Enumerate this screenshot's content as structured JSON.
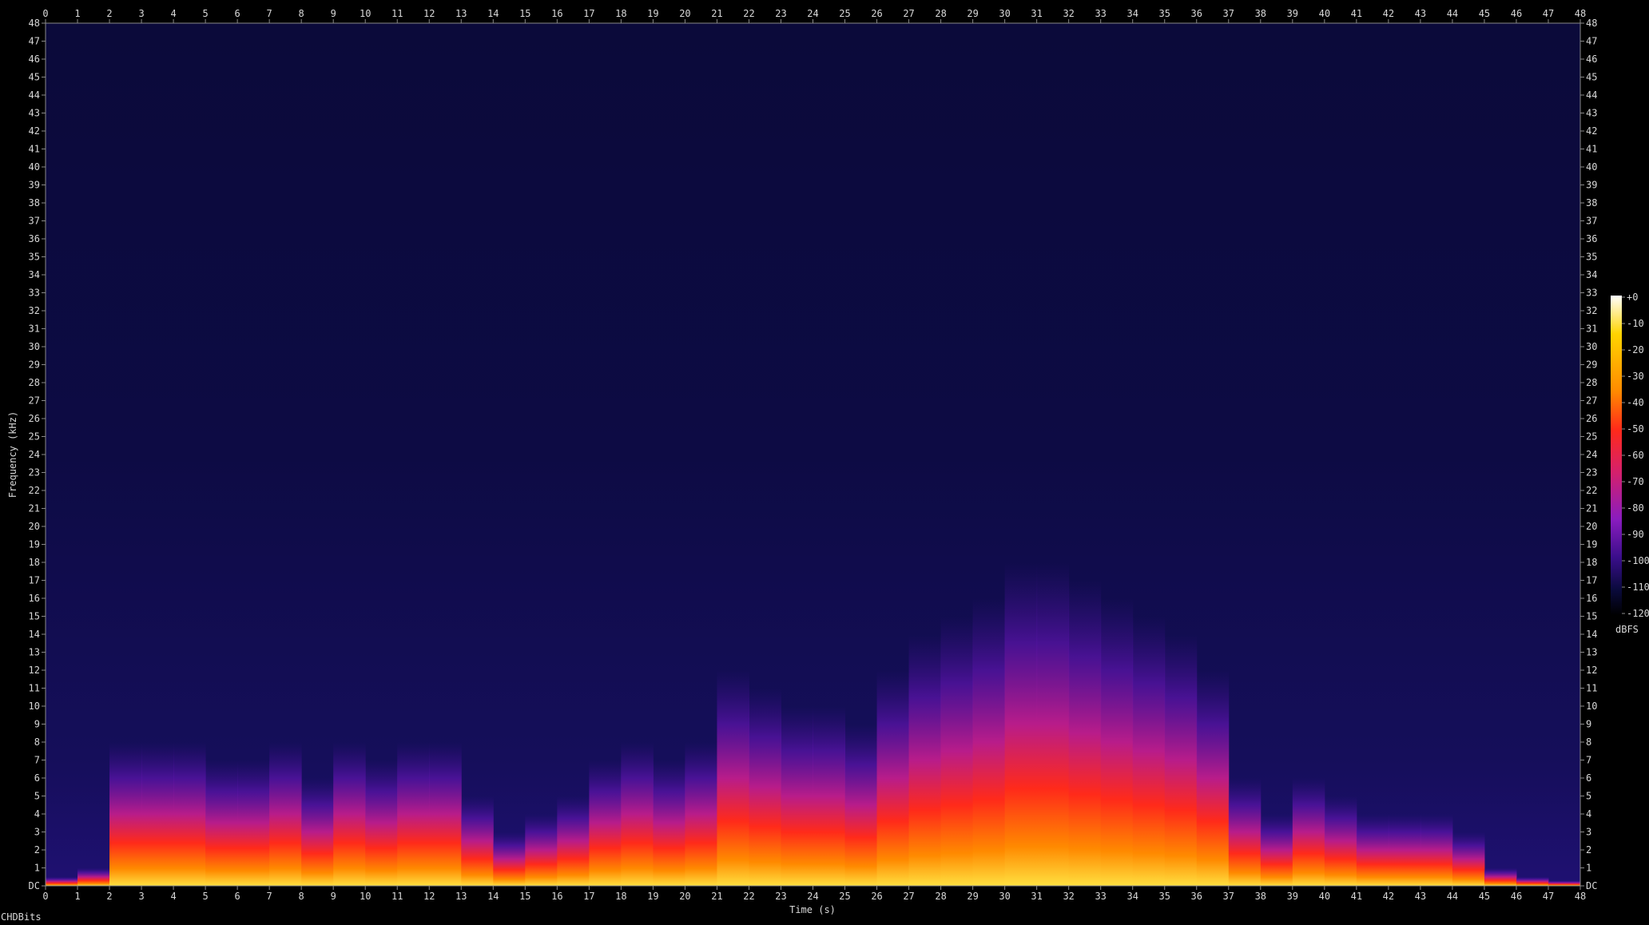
{
  "chart_data": {
    "type": "heatmap",
    "subtype": "spectrogram",
    "xlabel": "Time (s)",
    "ylabel": "Frequency (kHz)",
    "xlim": [
      0,
      48
    ],
    "ylim": [
      0,
      48
    ],
    "x_ticks": [
      "0",
      "1",
      "2",
      "3",
      "4",
      "5",
      "6",
      "7",
      "8",
      "9",
      "10",
      "11",
      "12",
      "13",
      "14",
      "15",
      "16",
      "17",
      "18",
      "19",
      "20",
      "21",
      "22",
      "23",
      "24",
      "25",
      "26",
      "27",
      "28",
      "29",
      "30",
      "31",
      "32",
      "33",
      "34",
      "35",
      "36",
      "37",
      "38",
      "39",
      "40",
      "41",
      "42",
      "43",
      "44",
      "45",
      "46",
      "47",
      "48"
    ],
    "y_ticks": [
      "DC",
      "1",
      "2",
      "3",
      "4",
      "5",
      "6",
      "7",
      "8",
      "9",
      "10",
      "11",
      "12",
      "13",
      "14",
      "15",
      "16",
      "17",
      "18",
      "19",
      "20",
      "21",
      "22",
      "23",
      "24",
      "25",
      "26",
      "27",
      "28",
      "29",
      "30",
      "31",
      "32",
      "33",
      "34",
      "35",
      "36",
      "37",
      "38",
      "39",
      "40",
      "41",
      "42",
      "43",
      "44",
      "45",
      "46",
      "47",
      "48"
    ],
    "colorbar": {
      "label": "dBFS",
      "ticks": [
        "+0",
        "-10",
        "-20",
        "-30",
        "-40",
        "-50",
        "-60",
        "-70",
        "-80",
        "-90",
        "-100",
        "-110",
        "-120"
      ],
      "range": [
        -120,
        0
      ],
      "colors": [
        "#000000",
        "#0a0a3c",
        "#3a0e8a",
        "#8a1cbf",
        "#d6206a",
        "#ff2a1a",
        "#ff8a00",
        "#ffd400",
        "#ffffff"
      ]
    },
    "energy_profile": {
      "description": "approximate upper frequency extent (kHz) of strong energy per second",
      "time_s": [
        0,
        1,
        2,
        3,
        4,
        5,
        6,
        7,
        8,
        9,
        10,
        11,
        12,
        13,
        14,
        15,
        16,
        17,
        18,
        19,
        20,
        21,
        22,
        23,
        24,
        25,
        26,
        27,
        28,
        29,
        30,
        31,
        32,
        33,
        34,
        35,
        36,
        37,
        38,
        39,
        40,
        41,
        42,
        43,
        44,
        45,
        46,
        47,
        48
      ],
      "extent_khz": [
        0.5,
        1,
        8,
        8,
        8,
        7,
        7,
        8,
        6,
        8,
        7,
        8,
        8,
        5,
        3,
        4,
        5,
        7,
        8,
        7,
        8,
        12,
        11,
        10,
        10,
        9,
        12,
        14,
        15,
        16,
        18,
        18,
        17,
        16,
        15,
        14,
        12,
        6,
        4,
        6,
        5,
        4,
        4,
        4,
        3,
        1,
        0.5,
        0.3,
        0.2
      ]
    },
    "background_dbfs": -105
  },
  "footer": {
    "brand": "CHDBits"
  }
}
